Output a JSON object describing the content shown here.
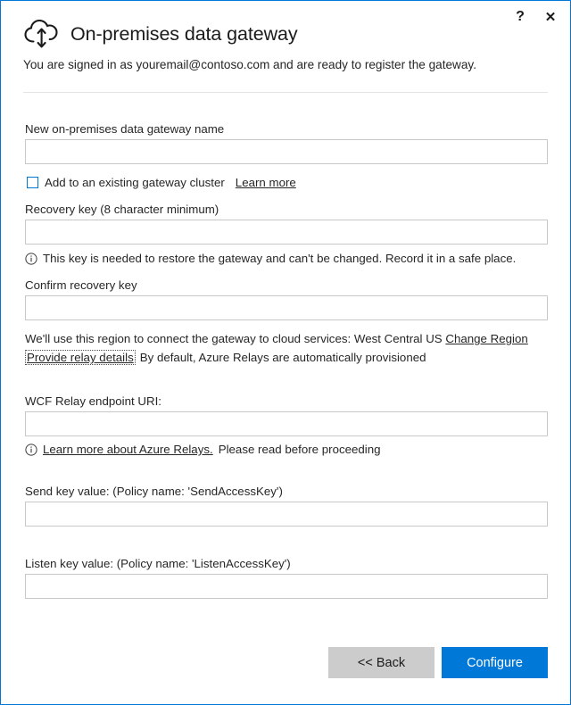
{
  "window": {
    "accent_color": "#0078D7",
    "border_color": "#0078D7",
    "background": "#ffffff"
  },
  "titlebar": {
    "help_label": "?",
    "close_label": "✕"
  },
  "header": {
    "icon": "cloud-upload-download-icon",
    "title": "On-premises data gateway",
    "status_text": "You are signed in as youremail@contoso.com and are ready to register the gateway."
  },
  "form": {
    "gateway_name": {
      "label": "New on-premises data gateway name",
      "value": "",
      "placeholder": ""
    },
    "cluster_checkbox": {
      "label": "Add to an existing gateway cluster",
      "checked": false,
      "link_label": "Learn more"
    },
    "recovery_key": {
      "label": "Recovery key (8 character minimum)",
      "value": "",
      "placeholder": "",
      "helper_icon": "info-icon",
      "helper_text": "This key is needed to restore the gateway and can't be changed. Record it in a safe place."
    },
    "confirm_recovery_key": {
      "label": "Confirm recovery key",
      "value": "",
      "placeholder": ""
    },
    "region": {
      "text": "We'll use this region to connect the gateway to cloud services: West Central US",
      "link_label": "Change Region"
    },
    "relay": {
      "link_label": "Provide relay details",
      "text": "By default, Azure Relays are automatically provisioned",
      "focused": true
    },
    "wcf_relay_uri": {
      "label": "WCF Relay endpoint URI:",
      "value": "",
      "placeholder": "",
      "helper_icon": "info-icon",
      "helper_link": "Learn more about Azure Relays.",
      "helper_text": "Please read before proceeding"
    },
    "send_key": {
      "label": "Send key value: (Policy name: 'SendAccessKey')",
      "value": "",
      "placeholder": ""
    },
    "listen_key": {
      "label": "Listen key value: (Policy name: 'ListenAccessKey')",
      "value": "",
      "placeholder": ""
    }
  },
  "footer": {
    "back_label": "<< Back",
    "configure_label": "Configure",
    "back_color": "#CCCCCC",
    "configure_color": "#0078D7"
  }
}
